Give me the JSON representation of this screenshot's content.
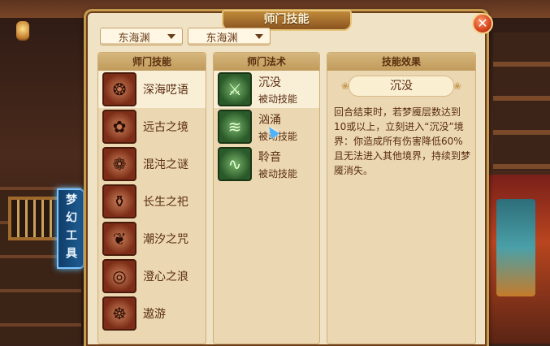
{
  "side_tab": {
    "label": "梦幻工具"
  },
  "window": {
    "title": "师门技能",
    "close_symbol": "✕",
    "dropdowns": [
      {
        "value": "东海渊"
      },
      {
        "value": "东海渊"
      }
    ]
  },
  "panels": {
    "skills_header": "师门技能",
    "spells_header": "师门法术",
    "effect_header": "技能效果"
  },
  "skills": [
    {
      "name": "深海呓语",
      "icon": "spiral-swirl-icon"
    },
    {
      "name": "远古之境",
      "icon": "flower-medallion-icon"
    },
    {
      "name": "混沌之谜",
      "icon": "flower-medallion-icon"
    },
    {
      "name": "长生之祀",
      "icon": "jar-icon"
    },
    {
      "name": "潮汐之咒",
      "icon": "scale-icon"
    },
    {
      "name": "澄心之浪",
      "icon": "ring-icon"
    },
    {
      "name": "遨游",
      "icon": "figure-icon"
    }
  ],
  "spells": [
    {
      "name": "沉没",
      "type": "被动技能",
      "icon": "swords-icon"
    },
    {
      "name": "汹涌",
      "type": "被动技能",
      "icon": "wave-icon"
    },
    {
      "name": "聆音",
      "type": "被动技能",
      "icon": "wave-icon"
    }
  ],
  "effect": {
    "name": "沉没",
    "description": "回合结束时，若梦魇层数达到10或以上，立刻进入“沉没”境界：你造成所有伤害降低60%且无法进入其他境界，持续到梦魇消失。"
  }
}
